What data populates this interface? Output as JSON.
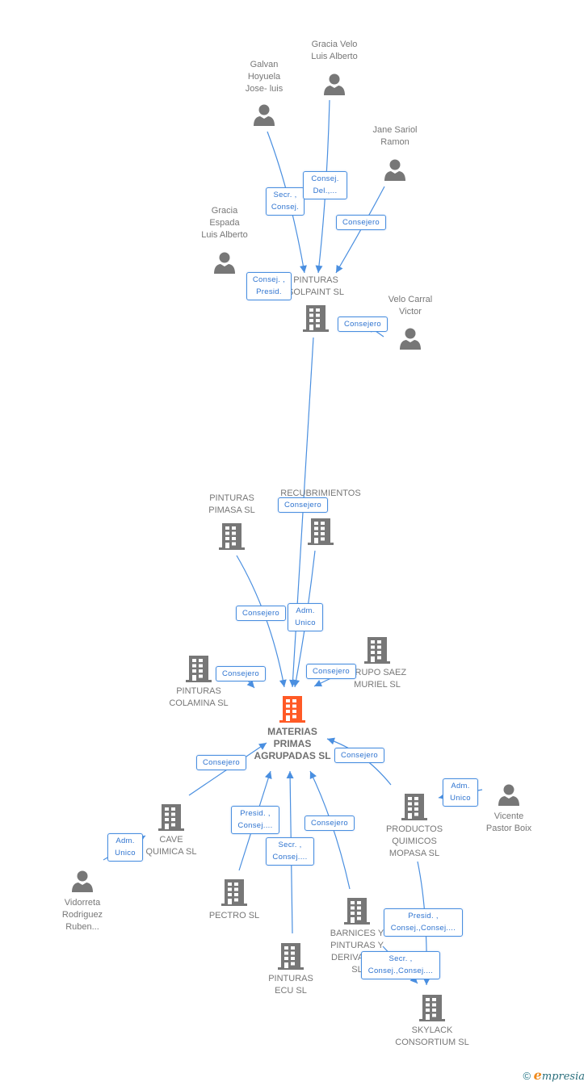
{
  "colors": {
    "edge": "#4a8fe0",
    "node": "#777777",
    "main_node": "#ff5a26",
    "badge_text": "#2f74d0"
  },
  "nodes": [
    {
      "type": "person",
      "lines": [
        "Gracia Velo",
        "Luis Alberto"
      ]
    },
    {
      "type": "person",
      "lines": [
        "Galvan",
        "Hoyuela",
        "Jose- luis"
      ]
    },
    {
      "type": "person",
      "lines": [
        "Jane Sariol",
        "Ramon"
      ]
    },
    {
      "type": "person",
      "lines": [
        "Gracia",
        "Espada",
        "Luis Alberto"
      ]
    },
    {
      "type": "person",
      "lines": [
        "Velo Carral",
        "Victor"
      ]
    },
    {
      "type": "company",
      "lines": [
        "PINTURAS",
        "SOLPAINT SL"
      ]
    },
    {
      "type": "company",
      "lines": [
        "PINTURAS",
        "PIMASA  SL"
      ]
    },
    {
      "type": "company",
      "lines": [
        "RECUBRIMIENTOS",
        "SL"
      ]
    },
    {
      "type": "company",
      "lines": [
        "PINTURAS",
        "COLAMINA SL"
      ]
    },
    {
      "type": "company",
      "lines": [
        "GRUPO SAEZ",
        "MURIEL SL"
      ]
    },
    {
      "type": "main",
      "lines": [
        "MATERIAS",
        "PRIMAS",
        "AGRUPADAS SL"
      ]
    },
    {
      "type": "company",
      "lines": [
        "CAVE",
        "QUIMICA SL"
      ]
    },
    {
      "type": "company",
      "lines": [
        "PECTRO SL"
      ]
    },
    {
      "type": "company",
      "lines": [
        "PINTURAS",
        "ECU  SL"
      ]
    },
    {
      "type": "company",
      "lines": [
        "BARNICES Y",
        "PINTURAS Y",
        "DERIVADOS",
        "SL"
      ]
    },
    {
      "type": "company",
      "lines": [
        "PRODUCTOS",
        "QUIMICOS",
        "MOPASA SL"
      ]
    },
    {
      "type": "company",
      "lines": [
        "SKYLACK",
        "CONSORTIUM SL"
      ]
    },
    {
      "type": "person",
      "lines": [
        "Vicente",
        "Pastor Boix"
      ]
    },
    {
      "type": "person",
      "lines": [
        "Vidorreta",
        "Rodriguez",
        "Ruben..."
      ]
    }
  ],
  "badges": [
    [
      "Secr. ,",
      "Consej."
    ],
    [
      "Consej.",
      "Del.,..."
    ],
    [
      "Consejero"
    ],
    [
      "Consej. ,",
      "Presid."
    ],
    [
      "Consejero"
    ],
    [
      "Consejero"
    ],
    [
      "Consejero"
    ],
    [
      "Adm.",
      "Unico"
    ],
    [
      "Consejero"
    ],
    [
      "Consejero"
    ],
    [
      "Consejero"
    ],
    [
      "Consejero"
    ],
    [
      "Adm.",
      "Unico"
    ],
    [
      "Adm.",
      "Unico"
    ],
    [
      "Presid. ,",
      "Consej...."
    ],
    [
      "Consejero"
    ],
    [
      "Secr. ,",
      "Consej...."
    ],
    [
      "Presid. ,",
      "Consej.,Consej...."
    ],
    [
      "Secr. ,",
      "Consej.,Consej...."
    ]
  ],
  "footer": {
    "copyright": "©",
    "brand_initial": "e",
    "brand_rest": "mpresia"
  }
}
